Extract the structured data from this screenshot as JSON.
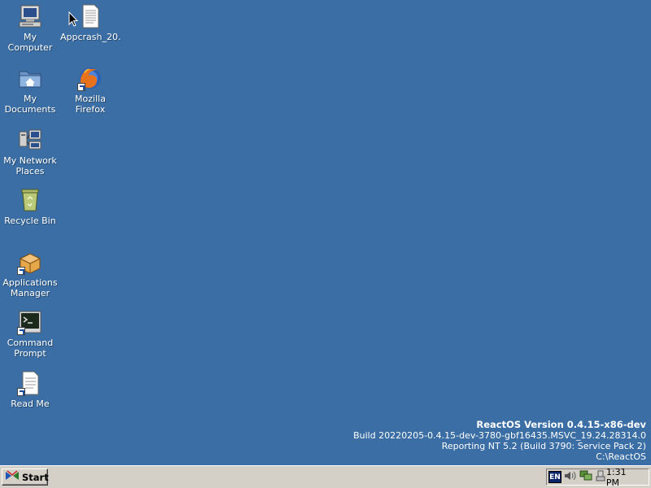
{
  "desktop": {
    "background": "#3a6ea5",
    "icons": [
      {
        "label": "My Computer",
        "icon": "computer-icon"
      },
      {
        "label": "My Documents",
        "icon": "folder-documents-icon"
      },
      {
        "label": "My Network Places",
        "icon": "network-icon"
      },
      {
        "label": "Recycle Bin",
        "icon": "recycle-bin-icon"
      },
      {
        "label": "Applications Manager",
        "icon": "package-icon"
      },
      {
        "label": "Command Prompt",
        "icon": "terminal-icon"
      },
      {
        "label": "Read Me",
        "icon": "document-icon"
      },
      {
        "label": "Appcrash_20...",
        "icon": "text-file-icon"
      },
      {
        "label": "Mozilla Firefox",
        "icon": "firefox-icon"
      }
    ]
  },
  "version_info": {
    "title": "ReactOS Version 0.4.15-x86-dev",
    "build": "Build 20220205-0.4.15-dev-3780-gbf16435.MSVC_19.24.28314.0",
    "reporting": "Reporting NT 5.2 (Build 3790: Service Pack 2)",
    "path": "C:\\ReactOS"
  },
  "taskbar": {
    "start_label": "Start",
    "language": "EN",
    "clock": "1:31 PM",
    "tray_icons": [
      "volume-icon",
      "network-tray-icon",
      "safely-remove-icon"
    ]
  }
}
